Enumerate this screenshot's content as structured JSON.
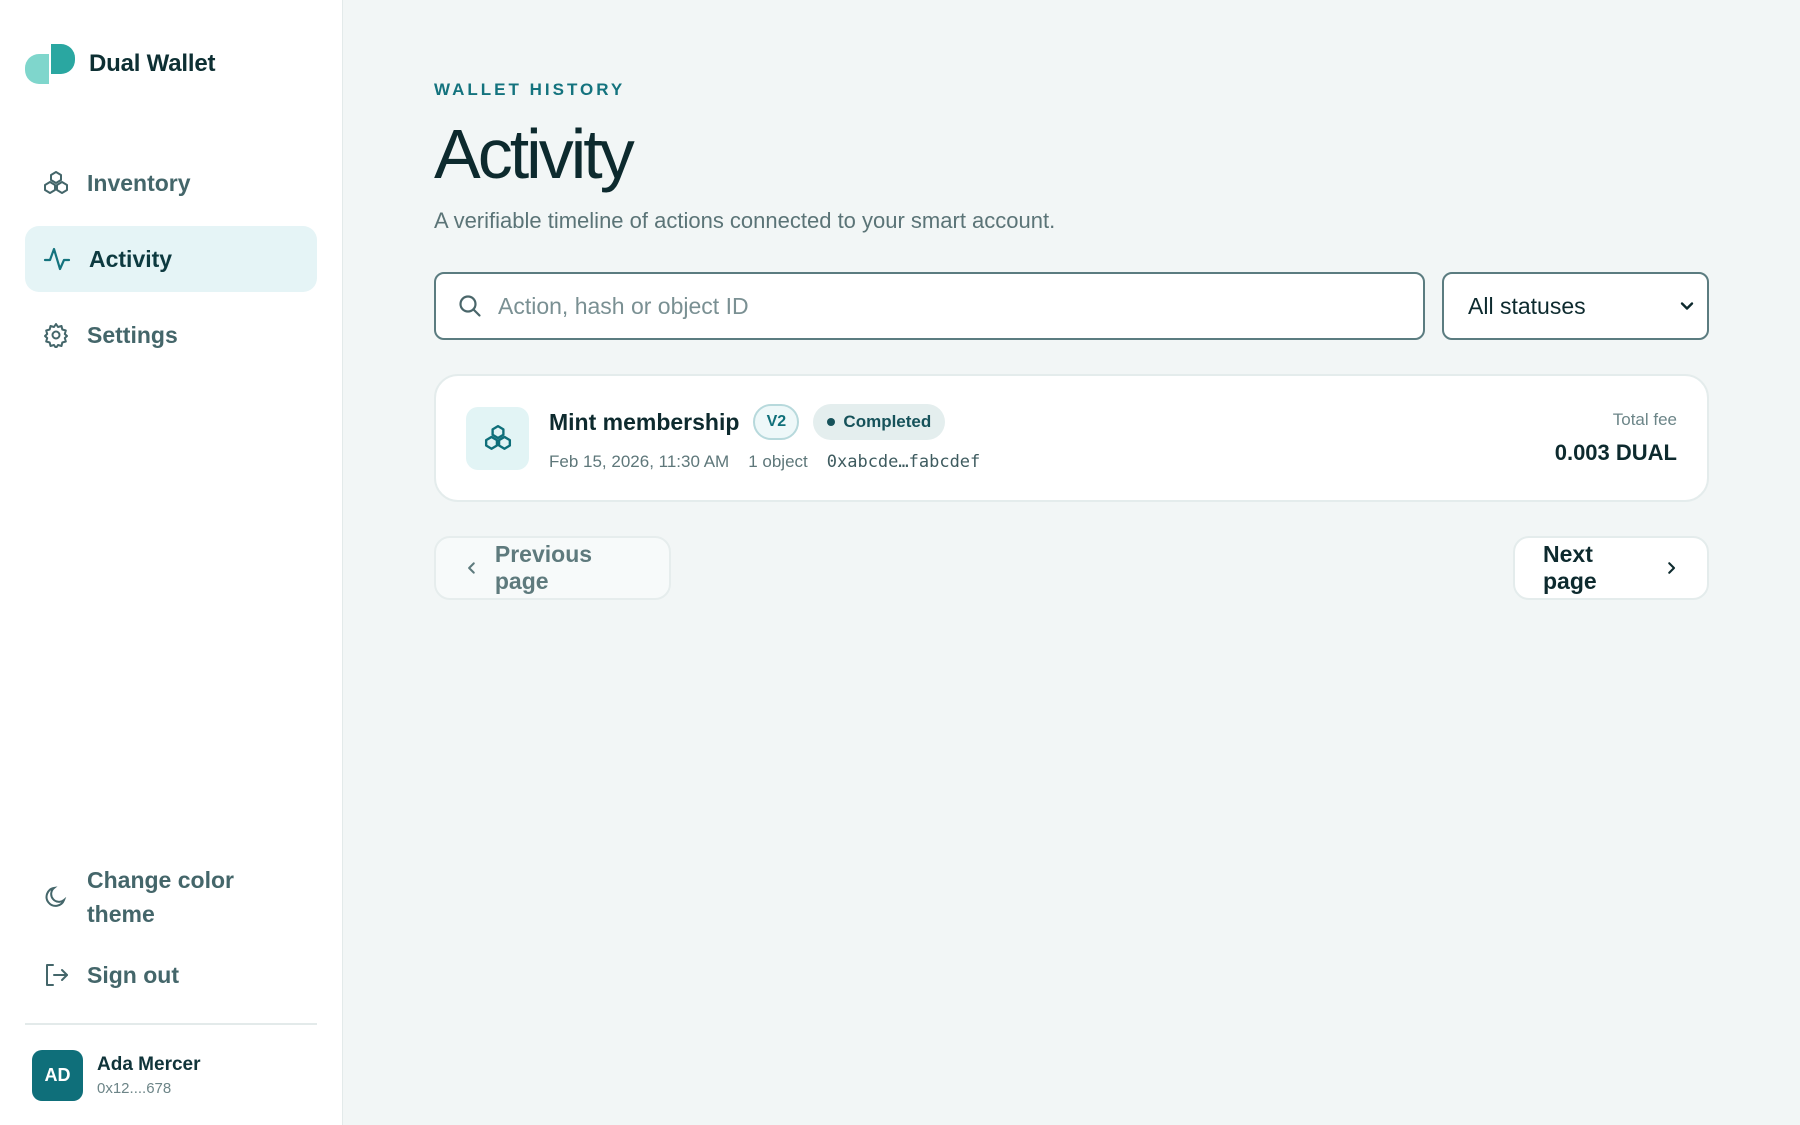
{
  "sidebar": {
    "brand": "Dual Wallet",
    "nav": [
      {
        "label": "Inventory",
        "icon": "cubes-icon",
        "active": false
      },
      {
        "label": "Activity",
        "icon": "activity-pulse-icon",
        "active": true
      },
      {
        "label": "Settings",
        "icon": "gear-icon",
        "active": false
      }
    ],
    "theme_label": "Change color theme",
    "signout_label": "Sign out",
    "user": {
      "initials": "AD",
      "name": "Ada Mercer",
      "address": "0x12....678"
    }
  },
  "header": {
    "eyebrow": "WALLET HISTORY",
    "title": "Activity",
    "subtitle": "A verifiable timeline of actions connected to your smart account."
  },
  "filters": {
    "search_placeholder": "Action, hash or object ID",
    "status_value": "All statuses"
  },
  "activity": [
    {
      "title": "Mint membership",
      "version": "V2",
      "status": "Completed",
      "date": "Feb 15, 2026, 11:30 AM",
      "objects": "1 object",
      "hash": "0xabcde…fabcdef",
      "fee_label": "Total fee",
      "fee_value": "0.003 DUAL"
    }
  ],
  "pager": {
    "prev_label": "Previous page",
    "next_label": "Next page"
  },
  "colors": {
    "accent": "#14737e",
    "avatar": "#0f6f7a",
    "active_nav": "#e5f4f6"
  }
}
